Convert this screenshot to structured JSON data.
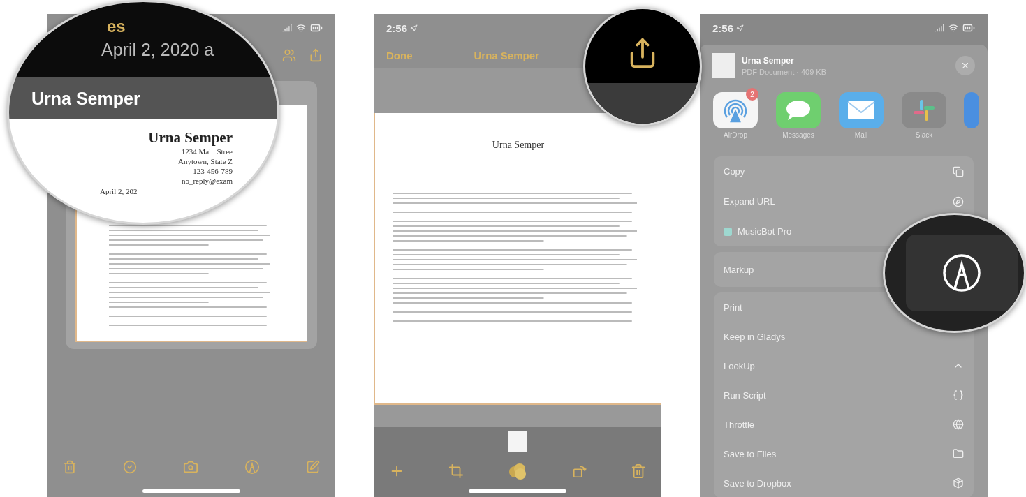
{
  "notes_screen": {
    "magnifier": {
      "back_label": "es",
      "date": "April 2, 2020 a",
      "title": "Urna Semper",
      "heading": "Urna Semper",
      "address_lines": [
        "1234 Main Stree",
        "Anytown, State Z",
        "123-456-789",
        "no_reply@exam"
      ],
      "date_line": "April 2, 202"
    }
  },
  "scan_screen": {
    "time": "2:56",
    "done": "Done",
    "title": "Urna Semper",
    "heading": "Urna Semper"
  },
  "share_screen": {
    "time": "2:56",
    "file": {
      "name": "Urna Semper",
      "info": "PDF Document · 409 KB"
    },
    "apps": [
      {
        "kind": "airdrop",
        "name": "AirDrop",
        "badge": "2"
      },
      {
        "kind": "messages",
        "name": "Messages"
      },
      {
        "kind": "mail",
        "name": "Mail"
      },
      {
        "kind": "slack",
        "name": "Slack"
      },
      {
        "kind": "partial"
      }
    ],
    "groups": [
      [
        {
          "kind": "copy",
          "label": "Copy"
        },
        {
          "kind": "compass",
          "label": "Expand URL"
        },
        {
          "kind": "app",
          "label": "MusicBot Pro"
        }
      ],
      [
        {
          "kind": "covered",
          "label": "Markup"
        }
      ],
      [
        {
          "kind": "covered",
          "label": "Print"
        },
        {
          "kind": "circle",
          "label": "Keep in Gladys"
        },
        {
          "kind": "chevron",
          "label": "LookUp"
        },
        {
          "kind": "braces",
          "label": "Run Script"
        },
        {
          "kind": "globe",
          "label": "Throttle"
        },
        {
          "kind": "folder",
          "label": "Save to Files"
        },
        {
          "kind": "box",
          "label": "Save to Dropbox"
        }
      ]
    ]
  }
}
